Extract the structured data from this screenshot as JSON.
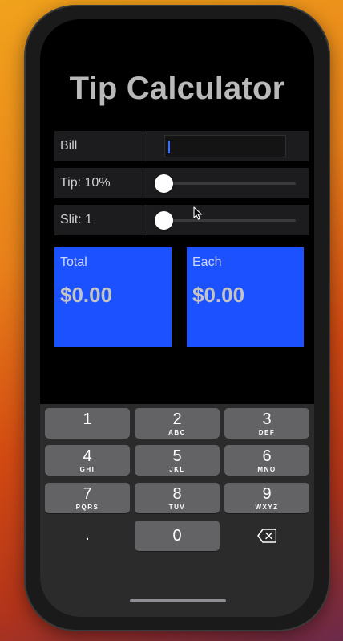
{
  "app": {
    "title": "Tip Calculator"
  },
  "form": {
    "bill_label": "Bill",
    "bill_value": "",
    "tip_label": "Tip: 10%",
    "tip_fraction": 0.1,
    "split_label": "Slit: 1",
    "split_fraction": 0.0
  },
  "results": {
    "total_label": "Total",
    "total_value": "$0.00",
    "each_label": "Each",
    "each_value": "$0.00",
    "card_color": "#1b51ff"
  },
  "keypad": {
    "keys": [
      {
        "num": "1",
        "letters": ""
      },
      {
        "num": "2",
        "letters": "ABC"
      },
      {
        "num": "3",
        "letters": "DEF"
      },
      {
        "num": "4",
        "letters": "GHI"
      },
      {
        "num": "5",
        "letters": "JKL"
      },
      {
        "num": "6",
        "letters": "MNO"
      },
      {
        "num": "7",
        "letters": "PQRS"
      },
      {
        "num": "8",
        "letters": "TUV"
      },
      {
        "num": "9",
        "letters": "WXYZ"
      }
    ],
    "dot": ".",
    "zero": "0",
    "delete_icon": "delete-backspace-icon"
  }
}
